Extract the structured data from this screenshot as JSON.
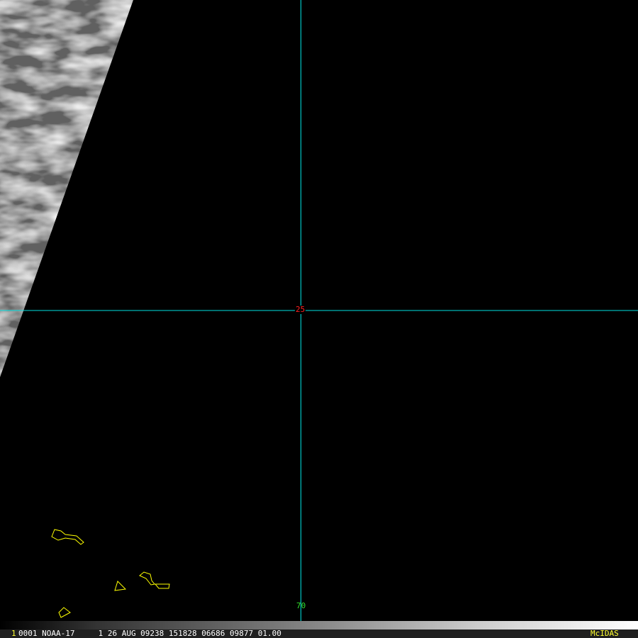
{
  "overlay": {
    "lat_label": "25",
    "lon_label": "70",
    "colors": {
      "grid": "#00e0e0",
      "coast": "#ffff00",
      "lat": "#ff2020",
      "lon": "#30e030"
    }
  },
  "status_bar": {
    "frame": "1",
    "info": "0001 NOAA-17     1 26 AUG 09238 151828 06686 09877 01.00",
    "brand": "McIDAS"
  }
}
